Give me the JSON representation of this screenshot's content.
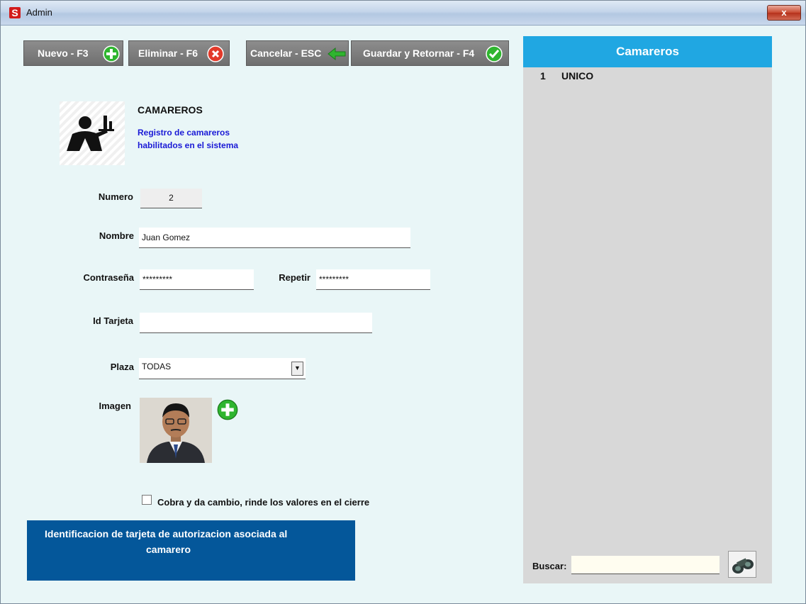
{
  "window": {
    "title": "Admin",
    "app_icon_letter": "S",
    "close_label": "x"
  },
  "toolbar": {
    "nuevo_label": "Nuevo - F3",
    "eliminar_label": "Eliminar - F6",
    "cancelar_label": "Cancelar - ESC",
    "guardar_label": "Guardar y Retornar - F4"
  },
  "header": {
    "title": "CAMAREROS",
    "subtitle_line1": "Registro de camareros",
    "subtitle_line2": "habilitados en el sistema"
  },
  "form": {
    "numero_label": "Numero",
    "numero_value": "2",
    "nombre_label": "Nombre",
    "nombre_value": "Juan Gomez",
    "contrasena_label": "Contraseña",
    "contrasena_value": "*********",
    "repetir_label": "Repetir",
    "repetir_value": "*********",
    "tarjeta_label": "Id Tarjeta",
    "tarjeta_value": "",
    "plaza_label": "Plaza",
    "plaza_value": "TODAS",
    "imagen_label": "Imagen",
    "checkbox_label": "Cobra y da cambio, rinde los valores en el cierre",
    "checkbox_checked": false
  },
  "info_box": {
    "line1": "Identificacion de tarjeta de autorizacion asociada al",
    "line2": "camarero"
  },
  "right_panel": {
    "title": "Camareros",
    "items": [
      {
        "num": "1",
        "name": "UNICO"
      }
    ],
    "search_label": "Buscar:",
    "search_value": ""
  },
  "colors": {
    "accent_header": "#20a7e2",
    "info_box": "#04579a",
    "toolbar_button": "#7a7a7a",
    "subtitle_text": "#1a1ad6"
  }
}
